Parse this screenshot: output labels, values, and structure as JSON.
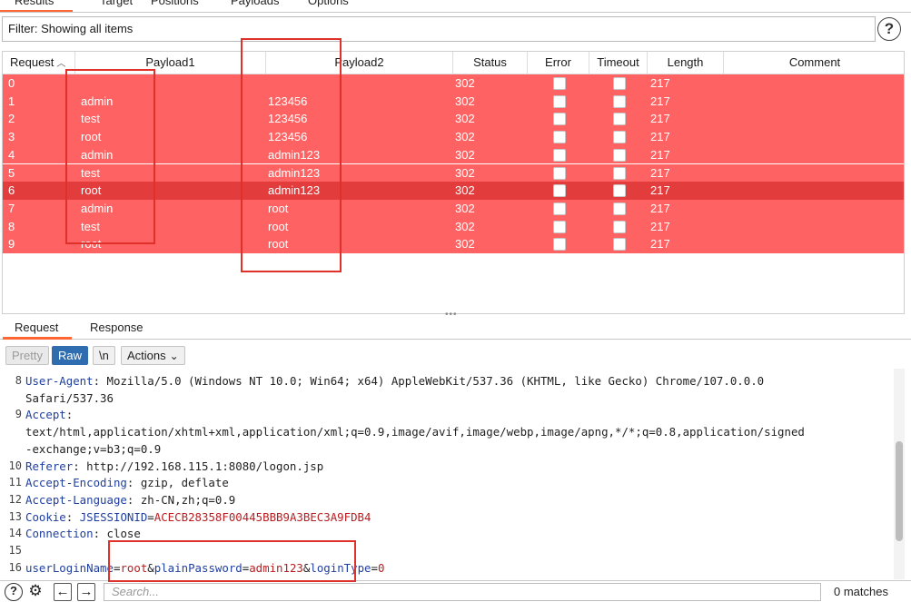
{
  "top_tabs": [
    {
      "label": "Results"
    },
    {
      "label": "Target"
    },
    {
      "label": "Positions"
    },
    {
      "label": "Payloads"
    },
    {
      "label": "Options"
    }
  ],
  "filter": {
    "text": "Filter: Showing all items"
  },
  "help_icon": "question-circle-icon",
  "table": {
    "columns": [
      "Request",
      "Payload1",
      "Payload2",
      "Status",
      "Error",
      "Timeout",
      "Length",
      "Comment"
    ],
    "rows": [
      {
        "request": "0",
        "payload1": "",
        "payload2": "",
        "status": "302",
        "error": false,
        "timeout": false,
        "length": "217",
        "comment": ""
      },
      {
        "request": "1",
        "payload1": "admin",
        "payload2": "123456",
        "status": "302",
        "error": false,
        "timeout": false,
        "length": "217",
        "comment": ""
      },
      {
        "request": "2",
        "payload1": "test",
        "payload2": "123456",
        "status": "302",
        "error": false,
        "timeout": false,
        "length": "217",
        "comment": ""
      },
      {
        "request": "3",
        "payload1": "root",
        "payload2": "123456",
        "status": "302",
        "error": false,
        "timeout": false,
        "length": "217",
        "comment": ""
      },
      {
        "request": "4",
        "payload1": "admin",
        "payload2": "admin123",
        "status": "302",
        "error": false,
        "timeout": false,
        "length": "217",
        "comment": ""
      },
      {
        "request": "5",
        "payload1": "test",
        "payload2": "admin123",
        "status": "302",
        "error": false,
        "timeout": false,
        "length": "217",
        "comment": ""
      },
      {
        "request": "6",
        "payload1": "root",
        "payload2": "admin123",
        "status": "302",
        "error": false,
        "timeout": false,
        "length": "217",
        "comment": "",
        "selected": true
      },
      {
        "request": "7",
        "payload1": "admin",
        "payload2": "root",
        "status": "302",
        "error": false,
        "timeout": false,
        "length": "217",
        "comment": ""
      },
      {
        "request": "8",
        "payload1": "test",
        "payload2": "root",
        "status": "302",
        "error": false,
        "timeout": false,
        "length": "217",
        "comment": ""
      },
      {
        "request": "9",
        "payload1": "root",
        "payload2": "root",
        "status": "302",
        "error": false,
        "timeout": false,
        "length": "217",
        "comment": ""
      }
    ],
    "row_color": "#ff6262",
    "selected_row_color": "#e23c3c"
  },
  "detail_tabs": [
    {
      "label": "Request"
    },
    {
      "label": "Response"
    }
  ],
  "toolbar": {
    "pretty_label": "Pretty",
    "raw_label": "Raw",
    "newline_label": "\\n",
    "actions_label": "Actions"
  },
  "editor_lines": [
    {
      "n": "8",
      "parts": [
        {
          "t": "User-Agent",
          "c": "k"
        },
        {
          "t": ": Mozilla/5.0 (Windows NT 10.0; Win64; x64) AppleWebKit/537.36 (KHTML, like Gecko) Chrome/107.0.0.0",
          "c": "p"
        }
      ]
    },
    {
      "n": "",
      "parts": [
        {
          "t": "Safari/537.36",
          "c": "p"
        }
      ]
    },
    {
      "n": "9",
      "parts": [
        {
          "t": "Accept",
          "c": "k"
        },
        {
          "t": ":",
          "c": "p"
        }
      ]
    },
    {
      "n": "",
      "parts": [
        {
          "t": "text/html,application/xhtml+xml,application/xml;q=0.9,image/avif,image/webp,image/apng,*/*;q=0.8,application/signed",
          "c": "p"
        }
      ]
    },
    {
      "n": "",
      "parts": [
        {
          "t": "-exchange;v=b3;q=0.9",
          "c": "p"
        }
      ]
    },
    {
      "n": "10",
      "parts": [
        {
          "t": "Referer",
          "c": "k"
        },
        {
          "t": ": http://192.168.115.1:8080/logon.jsp",
          "c": "p"
        }
      ]
    },
    {
      "n": "11",
      "parts": [
        {
          "t": "Accept-Encoding",
          "c": "k"
        },
        {
          "t": ": gzip, deflate",
          "c": "p"
        }
      ]
    },
    {
      "n": "12",
      "parts": [
        {
          "t": "Accept-Language",
          "c": "k"
        },
        {
          "t": ": zh-CN,zh;q=0.9",
          "c": "p"
        }
      ]
    },
    {
      "n": "13",
      "parts": [
        {
          "t": "Cookie",
          "c": "k"
        },
        {
          "t": ": ",
          "c": "p"
        },
        {
          "t": "JSESSIONID",
          "c": "k"
        },
        {
          "t": "=",
          "c": "p"
        },
        {
          "t": "ACECB28358F00445BBB9A3BEC3A9FDB4",
          "c": "v"
        }
      ]
    },
    {
      "n": "14",
      "parts": [
        {
          "t": "Connection",
          "c": "k"
        },
        {
          "t": ": close",
          "c": "p"
        }
      ]
    },
    {
      "n": "15",
      "parts": []
    },
    {
      "n": "16",
      "parts": [
        {
          "t": "userLoginName",
          "c": "k"
        },
        {
          "t": "=",
          "c": "p"
        },
        {
          "t": "root",
          "c": "v"
        },
        {
          "t": "&",
          "c": "p"
        },
        {
          "t": "plainPassword",
          "c": "k"
        },
        {
          "t": "=",
          "c": "p"
        },
        {
          "t": "admin123",
          "c": "v"
        },
        {
          "t": "&",
          "c": "p"
        },
        {
          "t": "loginType",
          "c": "k"
        },
        {
          "t": "=",
          "c": "p"
        },
        {
          "t": "0",
          "c": "v"
        }
      ]
    }
  ],
  "bottom": {
    "search_placeholder": "Search...",
    "matches_text": "0 matches",
    "icons": [
      "question-circle-icon",
      "gear-icon",
      "arrow-left-icon",
      "arrow-right-icon"
    ]
  },
  "highlight_color": "#e0302a"
}
